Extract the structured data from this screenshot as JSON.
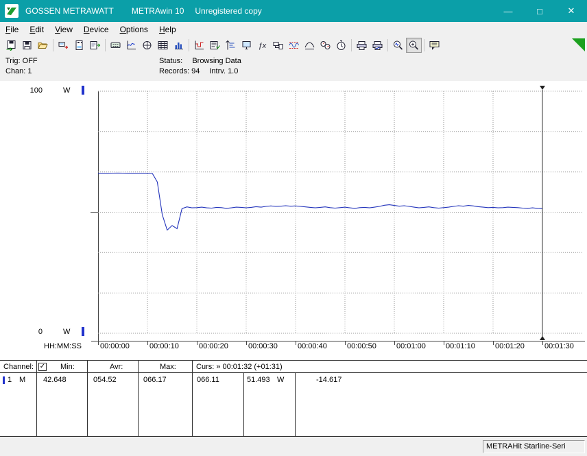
{
  "window": {
    "brand": "GOSSEN METRAWATT",
    "app": "METRAwin 10",
    "license": "Unregistered copy",
    "controls": [
      {
        "name": "minimize",
        "glyph": "—"
      },
      {
        "name": "maximize",
        "glyph": "□"
      },
      {
        "name": "close",
        "glyph": "✕"
      }
    ]
  },
  "menu": {
    "items": [
      "File",
      "Edit",
      "View",
      "Device",
      "Options",
      "Help"
    ]
  },
  "toolbar": {
    "icons": [
      "open-measurement-file",
      "save",
      "open-folder",
      "read-device",
      "memory-card",
      "export-data",
      "digital-display",
      "chart-yt",
      "analog-meter",
      "data-table",
      "histogram",
      "multichannel-chart",
      "channel-settings",
      "scale-settings",
      "monitor-view",
      "formula-function",
      "pc-transfer",
      "waveform-limits",
      "envelope-curve",
      "energy-meter",
      "stopwatch-interval",
      "print",
      "print-chart",
      "zoom-time",
      "zoom-mode",
      "comment-note"
    ],
    "active_icon": "zoom-mode"
  },
  "info": {
    "trig": "Trig: OFF",
    "chan": "Chan: 1",
    "status_label": "Status:",
    "status_value": "Browsing Data",
    "records": "Records: 94",
    "interval": "Intrv. 1.0"
  },
  "chart_data": {
    "type": "line",
    "title": "",
    "ylabel_top": "100",
    "ylabel_bottom": "0",
    "y_unit": "W",
    "ylim": [
      0,
      100
    ],
    "x_axis_label": "HH:MM:SS",
    "x_ticks": [
      "00:00:00",
      "00:00:10",
      "00:00:20",
      "00:00:30",
      "00:00:40",
      "00:00:50",
      "00:01:00",
      "00:01:10",
      "00:01:20",
      "00:01:30"
    ],
    "x_tick_interval_s": 10,
    "grid": true,
    "series": [
      {
        "name": "Channel 1",
        "unit": "W",
        "color": "#2233bb",
        "interval_s": 1,
        "start_s": 0,
        "values": [
          66.11,
          66.12,
          66.1,
          66.14,
          66.17,
          66.15,
          66.12,
          66.1,
          66.13,
          66.11,
          66.12,
          66.0,
          62.5,
          49.0,
          42.648,
          44.5,
          43.2,
          51.5,
          52.2,
          51.8,
          51.9,
          52.1,
          51.8,
          51.7,
          52.0,
          51.9,
          51.6,
          51.8,
          52.1,
          52.0,
          51.8,
          52.0,
          52.3,
          52.1,
          52.4,
          52.6,
          52.4,
          52.5,
          52.7,
          52.5,
          52.6,
          52.4,
          52.2,
          52.0,
          51.8,
          52.0,
          52.2,
          51.9,
          51.7,
          51.9,
          52.1,
          51.8,
          51.6,
          51.9,
          52.0,
          51.8,
          52.1,
          52.4,
          52.9,
          53.1,
          52.8,
          52.5,
          52.7,
          52.4,
          52.1,
          51.8,
          52.0,
          52.2,
          51.9,
          51.7,
          51.9,
          52.1,
          52.4,
          52.7,
          52.5,
          52.8,
          52.6,
          52.3,
          52.1,
          51.9,
          52.0,
          51.8,
          51.9,
          52.1,
          52.0,
          51.9,
          51.7,
          51.6,
          51.8,
          51.6,
          51.493
        ]
      }
    ],
    "cursor": {
      "t_s": 90,
      "time": "00:01:32",
      "offset": "(+01:31)"
    }
  },
  "cursor_table": {
    "headers": {
      "channel": "Channel:",
      "min": "Min:",
      "avr": "Avr:",
      "max": "Max:",
      "cursor": "Curs: » 00:01:32 (+01:31)"
    },
    "check_glyph": "✓",
    "row": {
      "channel": "1",
      "mode": "M",
      "min": "42.648",
      "avr": "054.52",
      "max": "066.17",
      "cursor1": "066.11",
      "cursor2": "51.493",
      "unit": "W",
      "delta": "-14.617"
    }
  },
  "statusbar": {
    "device": "METRAHit Starline-Seri"
  },
  "colors": {
    "titlebar": "#0b9fa8",
    "series": "#2233bb",
    "grid": "#9a9a9a",
    "channel_marker": "#2233cc"
  }
}
